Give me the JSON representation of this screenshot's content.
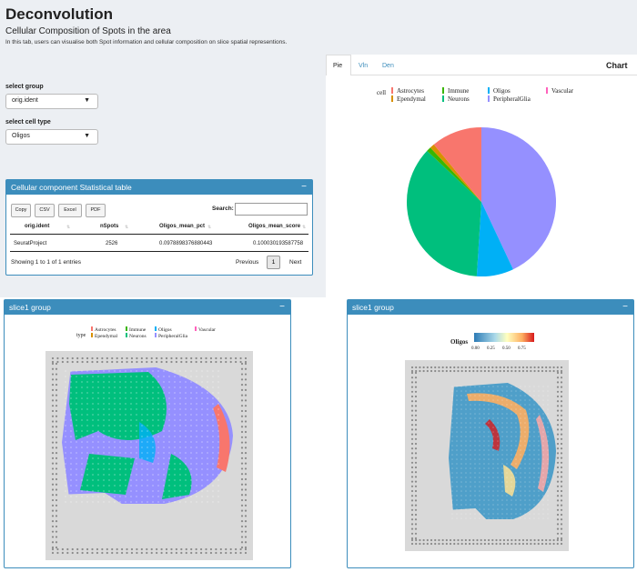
{
  "header": {
    "title": "Deconvolution",
    "subtitle": "Cellular Composition of Spots in the area",
    "description": "In this tab, users can visualise both Spot information and cellular composition on slice spatial representions."
  },
  "controls": {
    "group_label": "select group",
    "group_value": "orig.ident",
    "celltype_label": "select cell type",
    "celltype_value": "Oligos"
  },
  "stat_table": {
    "title": "Cellular component Statistical table",
    "minimize": "−",
    "buttons": [
      "Copy",
      "CSV",
      "Excel",
      "PDF"
    ],
    "search_label": "Search:",
    "columns": [
      "orig.ident",
      "nSpots",
      "Oligos_mean_pct",
      "Oligos_mean_score"
    ],
    "rows": [
      [
        "SeuratProject",
        "2526",
        "0.0978898376880443",
        "0.100030193587758"
      ]
    ],
    "info": "Showing 1 to 1 of 1 entries",
    "prev": "Previous",
    "page": "1",
    "next": "Next"
  },
  "chart_tabs": {
    "tabs": [
      "Pie",
      "Vln",
      "Den"
    ],
    "active": "Pie",
    "title": "Chart"
  },
  "pie_legend": {
    "title": "cell",
    "items": [
      {
        "label": "Astrocytes",
        "color": "#f8766d"
      },
      {
        "label": "Ependymal",
        "color": "#d89000"
      },
      {
        "label": "Immune",
        "color": "#39b600"
      },
      {
        "label": "Neurons",
        "color": "#00bf7d"
      },
      {
        "label": "Oligos",
        "color": "#00b0f6"
      },
      {
        "label": "PeripheralGlia",
        "color": "#9590ff"
      },
      {
        "label": "Vascular",
        "color": "#ff62bc"
      }
    ]
  },
  "chart_data": {
    "type": "pie",
    "categories": [
      "Astrocytes",
      "Ependymal",
      "Immune",
      "Neurons",
      "Oligos",
      "PeripheralGlia",
      "Vascular"
    ],
    "values": [
      11,
      1,
      1,
      36,
      8,
      43,
      0
    ],
    "colors": [
      "#f8766d",
      "#d89000",
      "#39b600",
      "#00bf7d",
      "#00b0f6",
      "#9590ff",
      "#ff62bc"
    ]
  },
  "slice_left": {
    "title": "slice1 group",
    "minimize": "−",
    "legend_title": "type",
    "legend_items": [
      {
        "label": "Astrocytes",
        "color": "#f8766d"
      },
      {
        "label": "Ependymal",
        "color": "#d89000"
      },
      {
        "label": "Immune",
        "color": "#39b600"
      },
      {
        "label": "Neurons",
        "color": "#00bf7d"
      },
      {
        "label": "Oligos",
        "color": "#00b0f6"
      },
      {
        "label": "PeripheralGlia",
        "color": "#9590ff"
      },
      {
        "label": "Vascular",
        "color": "#ff62bc"
      }
    ]
  },
  "slice_right": {
    "title": "slice1 group",
    "minimize": "−",
    "legend_title": "Oligos",
    "scale_ticks": [
      "0.00",
      "0.25",
      "0.50",
      "0.75"
    ]
  }
}
